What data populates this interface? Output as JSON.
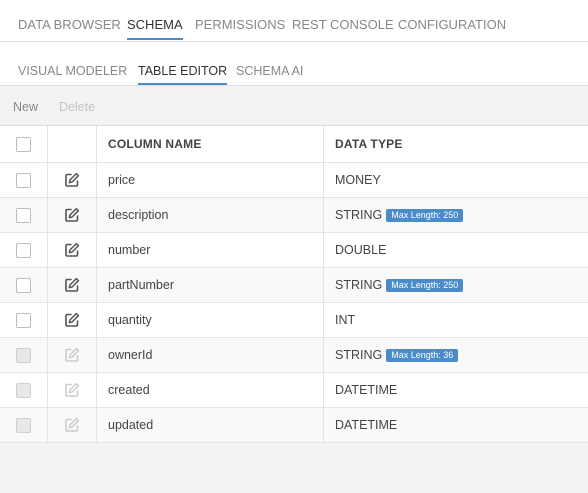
{
  "top_nav": {
    "tabs": [
      {
        "label": "DATA BROWSER"
      },
      {
        "label": "SCHEMA"
      },
      {
        "label": "PERMISSIONS"
      },
      {
        "label": "REST CONSOLE"
      },
      {
        "label": "CONFIGURATION"
      }
    ],
    "active": "SCHEMA"
  },
  "sub_nav": {
    "tabs": [
      {
        "label": "VISUAL MODELER"
      },
      {
        "label": "TABLE EDITOR"
      },
      {
        "label": "SCHEMA AI"
      }
    ],
    "active": "TABLE EDITOR"
  },
  "toolbar": {
    "new_label": "New",
    "delete_label": "Delete"
  },
  "table": {
    "headers": {
      "column_name": "COLUMN NAME",
      "data_type": "DATA TYPE"
    },
    "rows": [
      {
        "name": "price",
        "type": "MONEY",
        "badge": "",
        "editable": true
      },
      {
        "name": "description",
        "type": "STRING",
        "badge": "Max Length: 250",
        "editable": true
      },
      {
        "name": "number",
        "type": "DOUBLE",
        "badge": "",
        "editable": true
      },
      {
        "name": "partNumber",
        "type": "STRING",
        "badge": "Max Length: 250",
        "editable": true
      },
      {
        "name": "quantity",
        "type": "INT",
        "badge": "",
        "editable": true
      },
      {
        "name": "ownerId",
        "type": "STRING",
        "badge": "Max Length: 36",
        "editable": false
      },
      {
        "name": "created",
        "type": "DATETIME",
        "badge": "",
        "editable": false
      },
      {
        "name": "updated",
        "type": "DATETIME",
        "badge": "",
        "editable": false
      }
    ]
  },
  "icons": {
    "edit": "edit-icon"
  },
  "colors": {
    "accent": "#4a8bc9",
    "badge": "#4a8bc9",
    "edit_icon_enabled": "#555555",
    "edit_icon_disabled": "#cccccc"
  }
}
